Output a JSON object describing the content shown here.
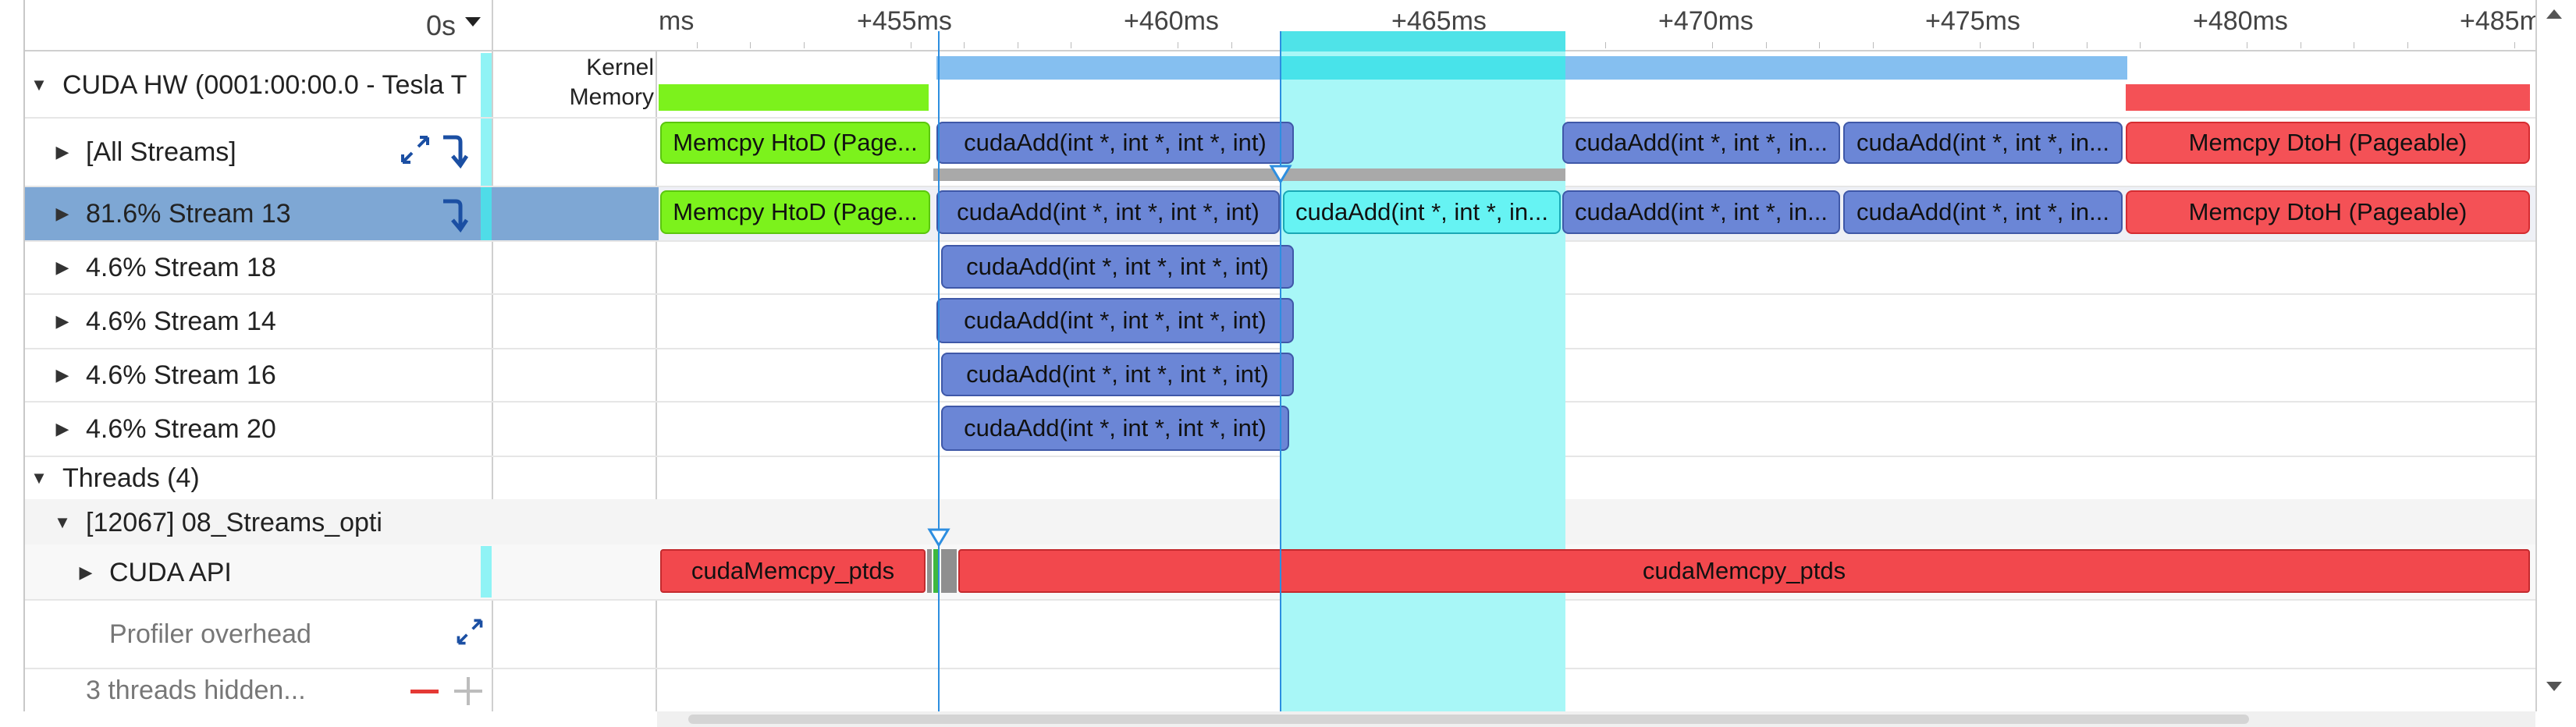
{
  "header": {
    "time_origin": "0s"
  },
  "ruler": {
    "ticks": [
      "ms",
      "+455ms",
      "+460ms",
      "+465ms",
      "+470ms",
      "+475ms",
      "+480ms",
      "+485ms"
    ]
  },
  "tree": {
    "cuda_hw": "CUDA HW (0001:00:00.0 - Tesla T",
    "kernel_label": "Kernel",
    "memory_label": "Memory",
    "all_streams": "[All Streams]",
    "streams": [
      {
        "label": "81.6% Stream 13"
      },
      {
        "label": "4.6% Stream 18"
      },
      {
        "label": "4.6% Stream 14"
      },
      {
        "label": "4.6% Stream 16"
      },
      {
        "label": "4.6% Stream 20"
      }
    ],
    "threads": "Threads (4)",
    "thread": "[12067] 08_Streams_opti",
    "cuda_api": "CUDA API",
    "profiler_overhead": "Profiler overhead",
    "threads_hidden": "3 threads hidden..."
  },
  "timeline": {
    "memcpy_htod": "Memcpy HtoD (Page...",
    "cuda_add_full": "cudaAdd(int *, int *, int *, int)",
    "cuda_add_trunc": "cudaAdd(int *, int *, in...",
    "memcpy_dtoh": "Memcpy DtoH (Pageable)",
    "cuda_memcpy": "cudaMemcpy_ptds"
  },
  "colors": {
    "selection": "#a8f7f7",
    "selected_row": "#7ea7d4",
    "kernel_blue": "#6b86d6",
    "memcpy_green": "#7cf21c",
    "memcpy_red": "#f45156",
    "cursor": "#2d8ee0"
  }
}
